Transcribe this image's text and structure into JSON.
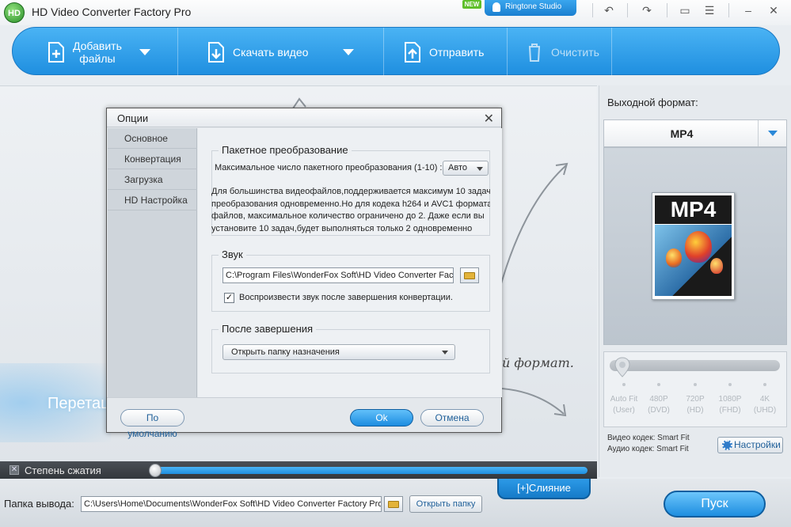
{
  "app": {
    "logo_text": "HD",
    "title": "HD Video Converter Factory Pro",
    "new_badge": "NEW",
    "ringtone_label": "Ringtone Studio"
  },
  "toolbar": {
    "add_files": "Добавить\nфайлы",
    "add_files_line1": "Добавить",
    "add_files_line2": "файлы",
    "download_video": "Скачать видео",
    "send": "Отправить",
    "clear": "Очистить"
  },
  "main": {
    "drop_text": "Перетащ",
    "script_text": "й формат."
  },
  "output_panel": {
    "label": "Выходной формат:",
    "format": "MP4",
    "card_text": "MP4",
    "quality_labels": [
      {
        "top": "Auto Fit",
        "bottom": "(User)"
      },
      {
        "top": "480P",
        "bottom": "(DVD)"
      },
      {
        "top": "720P",
        "bottom": "(HD)"
      },
      {
        "top": "1080P",
        "bottom": "(FHD)"
      },
      {
        "top": "4K",
        "bottom": "(UHD)"
      }
    ],
    "video_codec": "Видео кодек: Smart Fit",
    "audio_codec": "Аудио кодек: Smart Fit",
    "settings_button": "Настройки"
  },
  "compression": {
    "label": "Степень сжатия"
  },
  "bottom": {
    "merge_button": "[+]Слияние",
    "output_folder_label": "Папка вывода:",
    "output_path": "C:\\Users\\Home\\Documents\\WonderFox Soft\\HD Video Converter Factory Pro",
    "open_folder_button": "Открыть папку",
    "run_button": "Пуск"
  },
  "dialog": {
    "title": "Опции",
    "nav": [
      "Основное",
      "Конвертация",
      "Загрузка",
      "HD Настройка"
    ],
    "batch": {
      "title": "Пакетное преобразование",
      "max_label": "Максимальное число пакетного преобразования (1-10) :",
      "max_value": "Авто",
      "info": [
        "Для большинства видеофайлов,поддерживается максимум 10 задач",
        "преобразования одновременно.Но для кодека h264 и AVC1 формата",
        "файлов, максимальное количество ограничено до 2. Даже если вы",
        "установите 10 задач,будет выполняться только 2 одновременно"
      ]
    },
    "sound": {
      "title": "Звук",
      "path": "C:\\Program Files\\WonderFox Soft\\HD Video Converter Factory",
      "checkbox_label": "Воспроизвести звук после завершения конвертации.",
      "checked": "✓"
    },
    "after": {
      "title": "После завершения",
      "value": "Открыть папку назначения"
    },
    "default_button": "По умолчанию",
    "ok_button": "Ok",
    "cancel_button": "Отмена"
  }
}
